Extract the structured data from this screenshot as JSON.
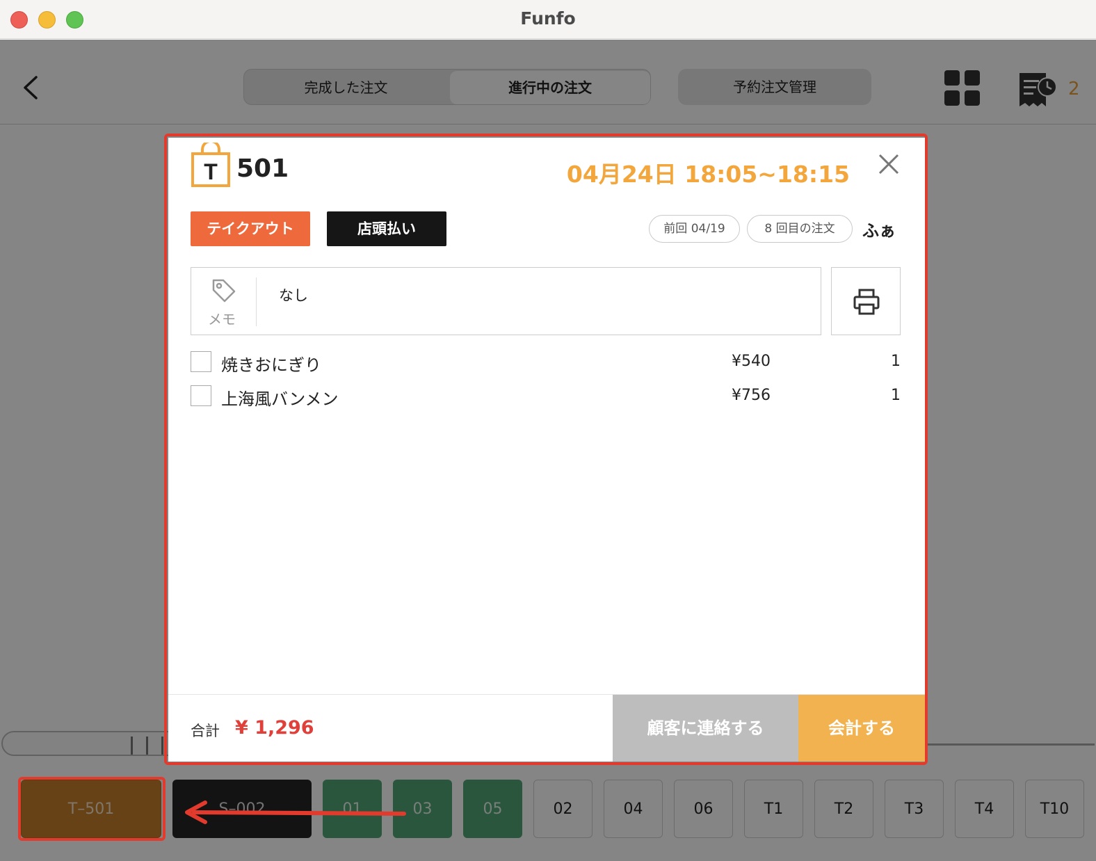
{
  "window": {
    "title": "Funfo"
  },
  "header": {
    "segments": [
      "完成した注文",
      "進行中の注文"
    ],
    "reserve_label": "予約注文管理",
    "receipt_count": "2"
  },
  "tabs": [
    {
      "label": "T–501",
      "style": "orange"
    },
    {
      "label": "S–002",
      "style": "black"
    },
    {
      "label": "01",
      "style": "green"
    },
    {
      "label": "03",
      "style": "green"
    },
    {
      "label": "05",
      "style": "green"
    },
    {
      "label": "02",
      "style": "plain"
    },
    {
      "label": "04",
      "style": "plain"
    },
    {
      "label": "06",
      "style": "plain"
    },
    {
      "label": "T1",
      "style": "plain"
    },
    {
      "label": "T2",
      "style": "plain"
    },
    {
      "label": "T3",
      "style": "plain"
    },
    {
      "label": "T4",
      "style": "plain"
    },
    {
      "label": "T10",
      "style": "plain"
    }
  ],
  "order": {
    "type_letter": "T",
    "number": "501",
    "time_slot": "04月24日 18:05~18:15",
    "takeout_label": "テイクアウト",
    "payment_label": "店頭払い",
    "last_visit": "前回 04/19",
    "order_count": "8 回目の注文",
    "customer_name": "ふぁ",
    "memo_label": "メモ",
    "memo_text": "なし",
    "items": [
      {
        "name": "焼きおにぎり",
        "price": "¥540",
        "qty": "1"
      },
      {
        "name": "上海風バンメン",
        "price": "¥756",
        "qty": "1"
      }
    ],
    "total_label": "合計",
    "total_value": "¥ 1,296",
    "contact_label": "顧客に連絡する",
    "checkout_label": "会計する"
  },
  "colors": {
    "accent_orange": "#f2a63c",
    "takeout_badge": "#ee6a3c",
    "total_red": "#e0403a",
    "annotation_red": "#e23b2e"
  }
}
